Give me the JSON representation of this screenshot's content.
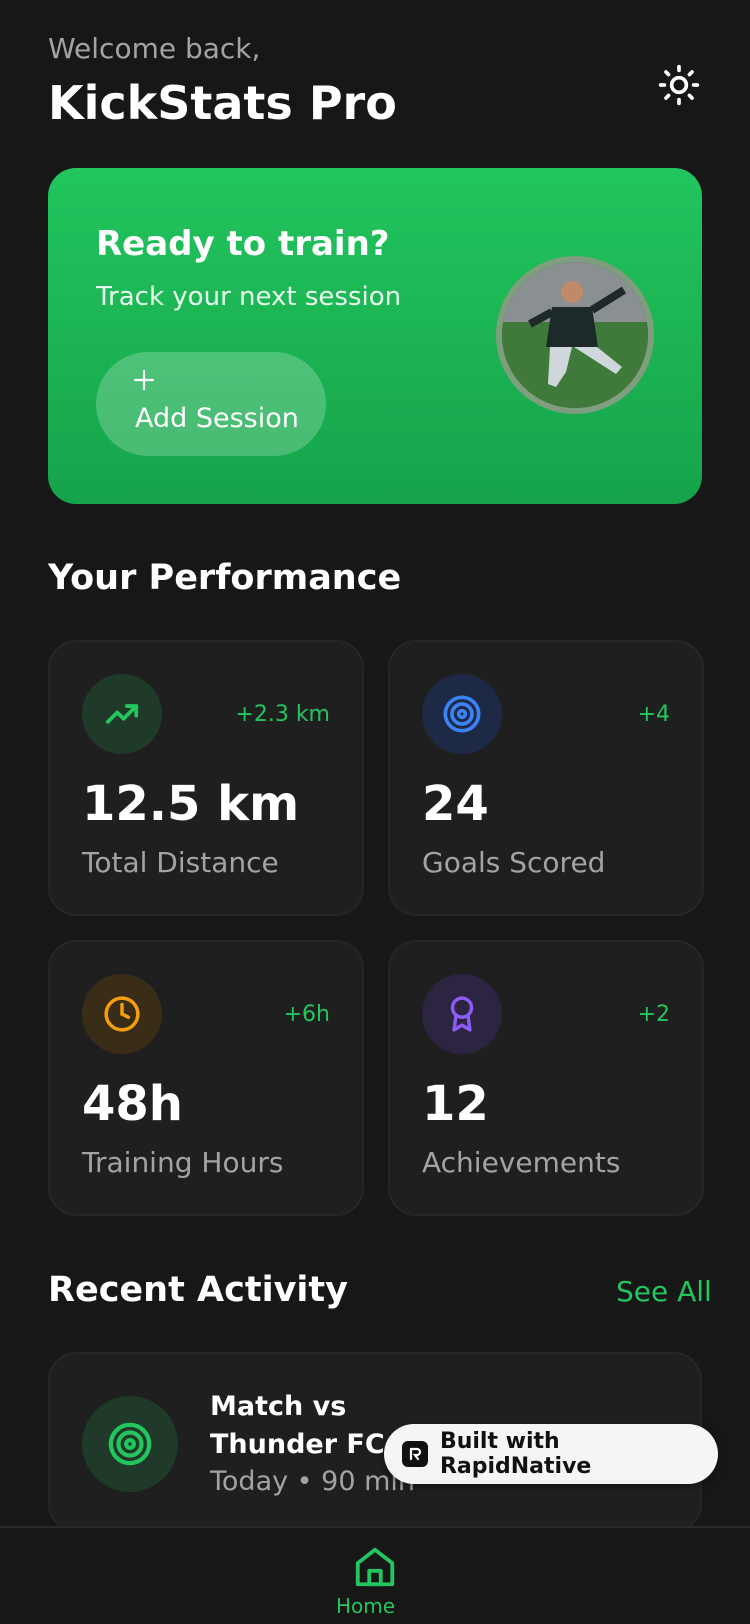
{
  "header": {
    "welcome": "Welcome back,",
    "title": "KickStats Pro",
    "theme_icon": "sun-icon"
  },
  "hero": {
    "title": "Ready to train?",
    "subtitle": "Track your next session",
    "button_label": "Add Session",
    "button_icon": "plus-icon"
  },
  "performance": {
    "title": "Your Performance",
    "stats": [
      {
        "value": "12.5 km",
        "label": "Total Distance",
        "delta": "+2.3 km",
        "icon": "trending-up-icon",
        "color": "#22c55e"
      },
      {
        "value": "24",
        "label": "Goals Scored",
        "delta": "+4",
        "icon": "target-icon",
        "color": "#3b82f6"
      },
      {
        "value": "48h",
        "label": "Training Hours",
        "delta": "+6h",
        "icon": "clock-icon",
        "color": "#f59e0b"
      },
      {
        "value": "12",
        "label": "Achievements",
        "delta": "+2",
        "icon": "award-icon",
        "color": "#8b5cf6"
      }
    ]
  },
  "recent": {
    "title": "Recent Activity",
    "see_all": "See All",
    "items": [
      {
        "title": "Match vs Thunder FC",
        "meta": "Today • 90 min",
        "icon": "target-icon"
      }
    ]
  },
  "badge": {
    "text": "Built with RapidNative"
  },
  "nav": {
    "home_label": "Home"
  },
  "colors": {
    "accent": "#22c55e",
    "background": "#171717",
    "card": "#1f1f1f"
  }
}
